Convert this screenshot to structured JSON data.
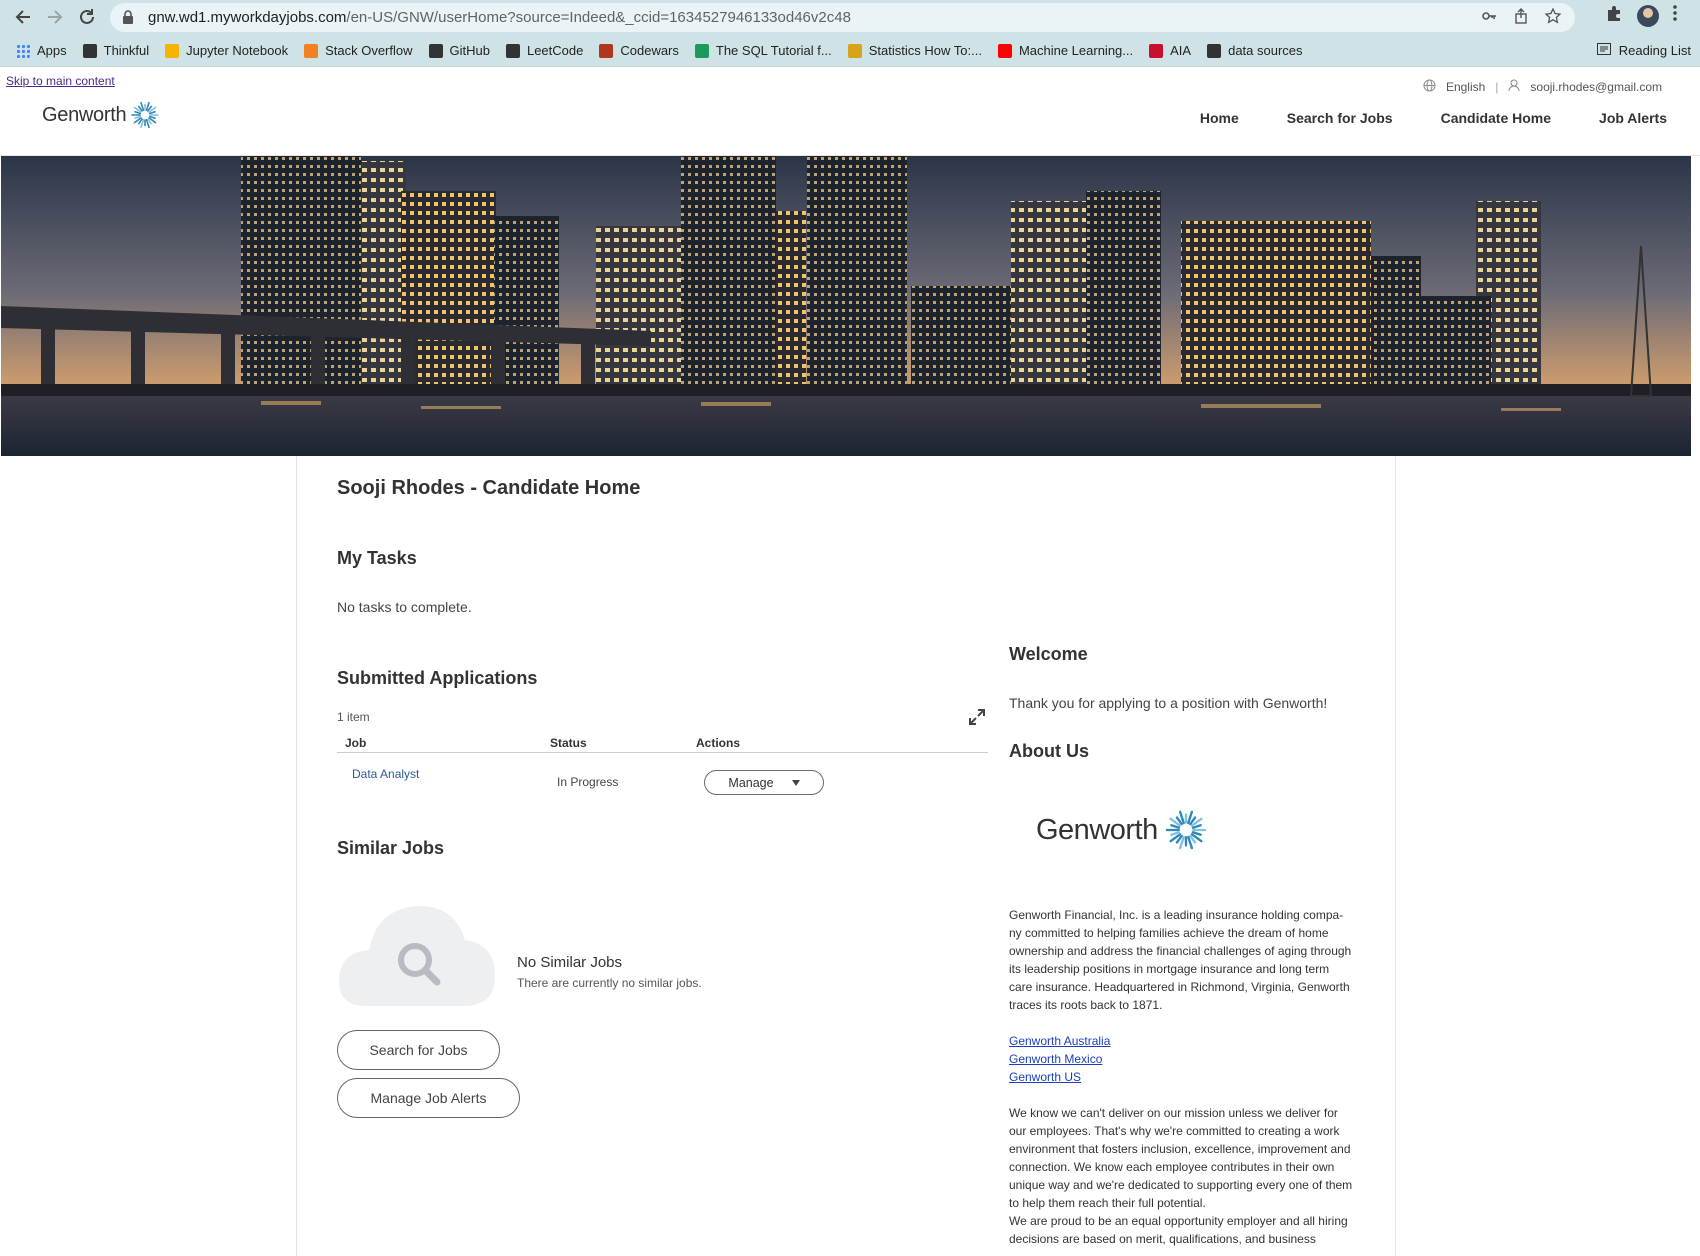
{
  "browser": {
    "url_host": "gnw.wd1.myworkdayjobs.com",
    "url_path": "/en-US/GNW/userHome?source=Indeed&_ccid=1634527946133od46v2c48",
    "bookmarks": [
      {
        "label": "Apps",
        "icon": "apps-grid-icon",
        "color": "#4285f4"
      },
      {
        "label": "Thinkful",
        "icon": "thinkful-icon",
        "color": "#333333"
      },
      {
        "label": "Jupyter Notebook",
        "icon": "drive-icon",
        "color": "#f4b400"
      },
      {
        "label": "Stack Overflow",
        "icon": "stackoverflow-icon",
        "color": "#f48024"
      },
      {
        "label": "GitHub",
        "icon": "github-icon",
        "color": "#333333"
      },
      {
        "label": "LeetCode",
        "icon": "leetcode-icon",
        "color": "#333333"
      },
      {
        "label": "Codewars",
        "icon": "codewars-icon",
        "color": "#b1361e"
      },
      {
        "label": "The SQL Tutorial f...",
        "icon": "gmail-icon",
        "color": "#1a9b5a"
      },
      {
        "label": "Statistics How To:...",
        "icon": "stats-icon",
        "color": "#d9a21b"
      },
      {
        "label": "Machine Learning...",
        "icon": "youtube-icon",
        "color": "#ff0000"
      },
      {
        "label": "AIA",
        "icon": "aia-icon",
        "color": "#c8102e"
      },
      {
        "label": "data sources",
        "icon": "github-icon",
        "color": "#333333"
      }
    ],
    "reading_list": "Reading List"
  },
  "header": {
    "skip_link": "Skip to main content",
    "logo": "Genworth",
    "language": "English",
    "user_email": "sooji.rhodes@gmail.com",
    "nav": [
      "Home",
      "Search for Jobs",
      "Candidate Home",
      "Job Alerts"
    ]
  },
  "main": {
    "title": "Sooji Rhodes - Candidate Home",
    "tasks": {
      "heading": "My Tasks",
      "empty": "No tasks to complete."
    },
    "applications": {
      "heading": "Submitted Applications",
      "count": "1 item",
      "columns": [
        "Job",
        "Status",
        "Actions"
      ],
      "rows": [
        {
          "job": "Data Analyst",
          "status": "In Progress",
          "action": "Manage"
        }
      ]
    },
    "similar": {
      "heading": "Similar Jobs",
      "empty_title": "No Similar Jobs",
      "empty_sub": "There are currently no similar jobs.",
      "search_button": "Search for Jobs",
      "alerts_button": "Manage Job Alerts"
    }
  },
  "sidebar": {
    "welcome_heading": "Welcome",
    "welcome_text": "Thank you for applying to a position with Genworth!",
    "about_heading": "About Us",
    "about_logo": "Genworth",
    "about_text": "Genworth Financial, Inc. is a leading insurance holding compa-ny committed to helping families achieve the dream of home ownership and address the financial challenges of aging through its leadership positions in mortgage insurance and long term care insurance. Headquartered in Richmond, Virginia, Genworth traces its roots back to 1871.",
    "links": [
      "Genworth Australia",
      "Genworth Mexico",
      "Genworth US"
    ],
    "mission_text": "We know we can't deliver on our mission unless we deliver for our employees. That's why we're committed to creating a work environment that fosters inclusion, excellence, improvement and connection. We know each employee contributes in their own unique way and we're dedicated to supporting every one of them to help them reach their full potential.",
    "eeo_text": "We are proud to be an equal opportunity employer and all hiring decisions are based on merit, qualifications, and business"
  }
}
